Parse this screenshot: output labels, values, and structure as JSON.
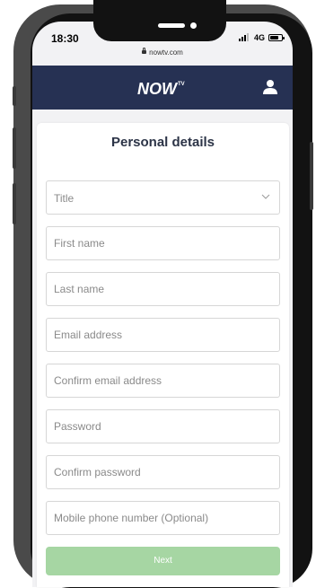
{
  "status_bar": {
    "time": "18:30",
    "network": "4G",
    "battery_level": 0.75
  },
  "browser": {
    "url": "nowtv.com"
  },
  "header": {
    "logo_text": "NOW",
    "logo_superscript": "TV",
    "profile_icon": "user-icon"
  },
  "form": {
    "title": "Personal details",
    "title_select": {
      "label": "Title",
      "icon": "chevron-down-icon"
    },
    "fields": {
      "first_name": "First name",
      "last_name": "Last name",
      "email": "Email address",
      "confirm_email": "Confirm email address",
      "password": "Password",
      "confirm_password": "Confirm password",
      "mobile": "Mobile phone number (Optional)"
    },
    "next_label": "Next"
  },
  "colors": {
    "header_bg": "#263153",
    "next_button_bg": "#a6d6a3",
    "title_text": "#2c3447",
    "field_border": "#d6d6d6"
  }
}
